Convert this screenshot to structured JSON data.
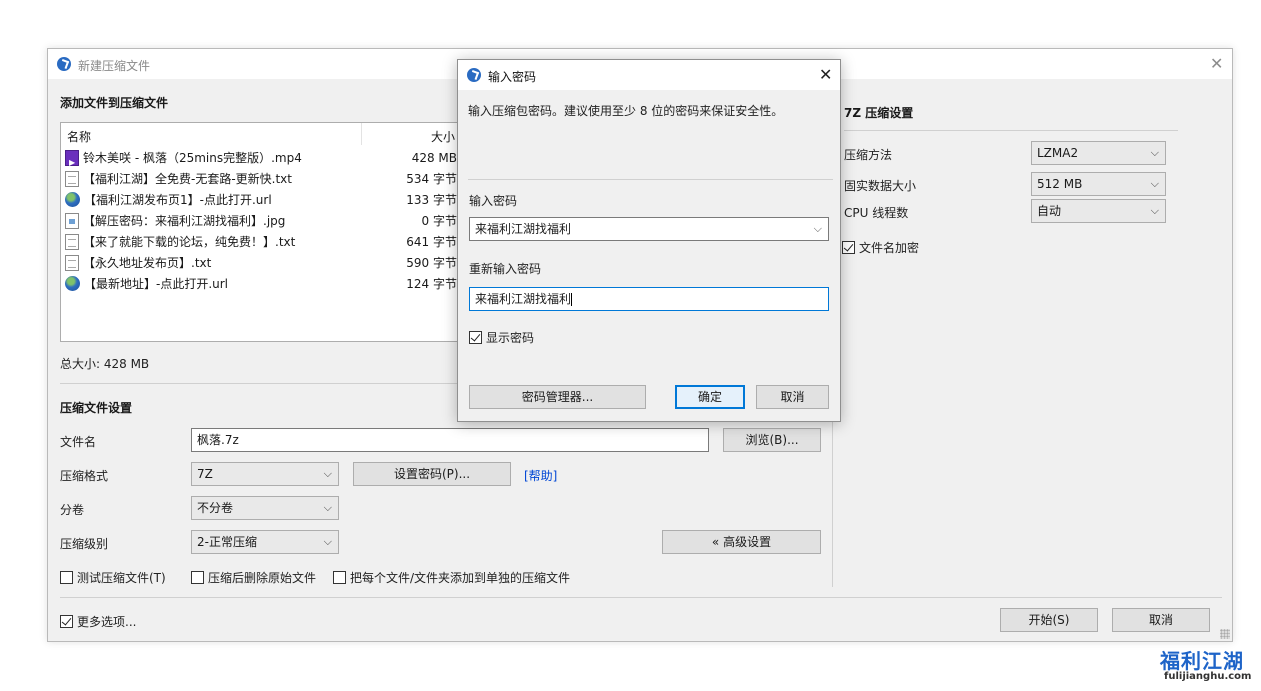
{
  "main_window": {
    "title": "新建压缩文件",
    "add_files_title": "添加文件到压缩文件",
    "columns": {
      "name": "名称",
      "size": "大小"
    },
    "files": [
      {
        "icon": "video-file-icon",
        "name": "铃木美咲 - 枫落（25mins完整版）.mp4",
        "size": "428 MB"
      },
      {
        "icon": "text-file-icon",
        "name": "【福利江湖】全免费-无套路-更新快.txt",
        "size": "534 字节"
      },
      {
        "icon": "url-file-icon",
        "name": "【福利江湖发布页1】-点此打开.url",
        "size": "133 字节"
      },
      {
        "icon": "image-file-icon",
        "name": "【解压密码：来福利江湖找福利】.jpg",
        "size": "0 字节"
      },
      {
        "icon": "text-file-icon",
        "name": "【来了就能下载的论坛，纯免费！】.txt",
        "size": "641 字节"
      },
      {
        "icon": "text-file-icon",
        "name": "【永久地址发布页】.txt",
        "size": "590 字节"
      },
      {
        "icon": "url-file-icon",
        "name": "【最新地址】-点此打开.url",
        "size": "124 字节"
      }
    ],
    "total_size": "总大小: 428 MB",
    "settings_title": "压缩文件设置",
    "filename_label": "文件名",
    "filename_value": "枫落.7z",
    "browse_button": "浏览(B)...",
    "format_label": "压缩格式",
    "format_value": "7Z",
    "set_password_button": "设置密码(P)...",
    "help_link": "[帮助]",
    "split_label": "分卷",
    "split_value": "不分卷",
    "level_label": "压缩级别",
    "level_value": "2-正常压缩",
    "advanced_button": "« 高级设置",
    "test_archive": "测试压缩文件(T)",
    "delete_after": "压缩后删除原始文件",
    "separate_archives": "把每个文件/文件夹添加到单独的压缩文件",
    "more_options": "更多选项...",
    "start_button": "开始(S)",
    "cancel_button": "取消",
    "sevenz": {
      "title": "7Z 压缩设置",
      "method_label": "压缩方法",
      "method_value": "LZMA2",
      "solid_label": "固实数据大小",
      "solid_value": "512 MB",
      "threads_label": "CPU 线程数",
      "threads_value": "自动",
      "encrypt_names": "文件名加密"
    }
  },
  "password_dialog": {
    "title": "输入密码",
    "hint": "输入压缩包密码。建议使用至少 8 位的密码来保证安全性。",
    "password_label": "输入密码",
    "password_value": "来福利江湖找福利",
    "reenter_label": "重新输入密码",
    "reenter_value": "来福利江湖找福利",
    "show_password": "显示密码",
    "manager_button": "密码管理器...",
    "ok_button": "确定",
    "cancel_button": "取消"
  },
  "watermark": {
    "logo": "福利江湖",
    "domain": "fulijianghu.com"
  }
}
